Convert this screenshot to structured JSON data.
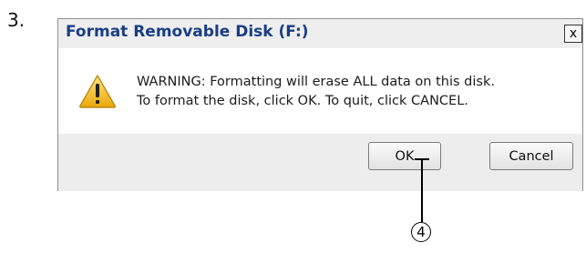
{
  "step": {
    "number": "3."
  },
  "dialog": {
    "title": "Format Removable Disk (F:)",
    "close_label": "x",
    "icon": "warning-icon",
    "message": {
      "line1": "WARNING: Formatting will erase ALL data on this disk.",
      "line2": "To format the disk, click OK. To quit, click CANCEL."
    },
    "buttons": {
      "ok_label": "OK",
      "cancel_label": "Cancel"
    }
  },
  "callout": {
    "label": "4"
  },
  "colors": {
    "title_text": "#1a3e86",
    "warning_fill": "#f2c21b",
    "dialog_bg": "#ededed"
  }
}
